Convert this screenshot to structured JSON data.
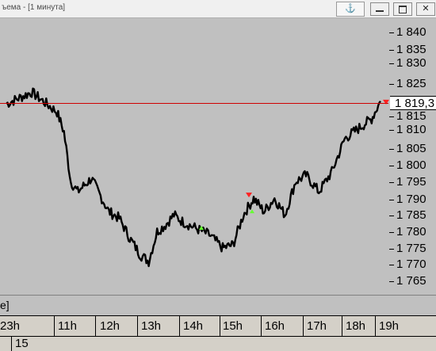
{
  "window": {
    "title": "ъема - [1 минута]",
    "anchor_glyph": "⚓",
    "close_glyph": "✕"
  },
  "price_axis": {
    "labels": [
      "1 840",
      "1 835",
      "1 830",
      "1 825",
      "1 815",
      "1 810",
      "1 805",
      "1 800",
      "1 795",
      "1 790",
      "1 785",
      "1 780",
      "1 775",
      "1 770",
      "1 765"
    ],
    "current_price_label": "1 819,3"
  },
  "indicator": {
    "label": "e]"
  },
  "time_axis": {
    "labels": [
      "23h",
      "11h",
      "12h",
      "13h",
      "14h",
      "15h",
      "16h",
      "17h",
      "18h",
      "19h"
    ]
  },
  "date_axis": {
    "label": "15"
  },
  "colors": {
    "background": "#c0c0c0",
    "price_line": "#d00000",
    "series": "#000000",
    "buy_marker": "#66ff33",
    "sell_marker": "#ff2020"
  },
  "chart_data": {
    "type": "line",
    "x": [
      "23h",
      "23h",
      "11h",
      "11h",
      "11h",
      "11h",
      "11h",
      "11h",
      "12h",
      "12h",
      "12h",
      "12h",
      "13h",
      "13h",
      "13h",
      "13h",
      "13h",
      "14h",
      "14h",
      "14h",
      "15h",
      "15h",
      "15h",
      "15h",
      "16h",
      "16h",
      "16h",
      "16h",
      "17h",
      "17h",
      "17h",
      "18h",
      "18h",
      "18h",
      "18h",
      "19h"
    ],
    "y": [
      1818.5,
      1822,
      1816,
      1810,
      1795,
      1792,
      1794,
      1796,
      1792,
      1786,
      1784,
      1778,
      1773,
      1771,
      1780,
      1782,
      1785,
      1783,
      1781,
      1779,
      1775,
      1776,
      1785,
      1790,
      1786,
      1790,
      1785,
      1795,
      1797,
      1792,
      1798,
      1808,
      1810,
      1812,
      1814,
      1819.3
    ],
    "series": [
      {
        "name": ""
      }
    ],
    "markers": [
      {
        "type": "buy",
        "x": "14h",
        "y": 1781
      },
      {
        "type": "sell",
        "x": "15h",
        "y": 1791
      },
      {
        "type": "buy",
        "x": "16h",
        "y": 1786
      },
      {
        "type": "sell",
        "x": "19h",
        "y": 1819
      }
    ],
    "ylim": [
      1764,
      1842
    ],
    "current_price": 1819.3,
    "title": "",
    "xlabel": "",
    "ylabel": ""
  }
}
